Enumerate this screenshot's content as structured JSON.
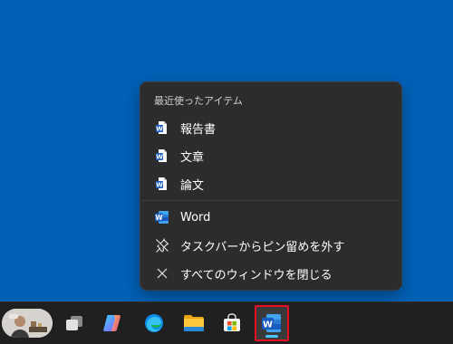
{
  "jumplist": {
    "header": "最近使ったアイテム",
    "recent_items": [
      {
        "label": "報告書",
        "icon": "word-document-icon"
      },
      {
        "label": "文章",
        "icon": "word-document-icon"
      },
      {
        "label": "論文",
        "icon": "word-document-icon"
      }
    ],
    "app_item": {
      "label": "Word",
      "icon": "word-app-icon"
    },
    "unpin_item": {
      "label": "タスクバーからピン留めを外す",
      "icon": "unpin-icon"
    },
    "close_all_item": {
      "label": "すべてのウィンドウを閉じる",
      "icon": "close-icon"
    }
  },
  "taskbar": {
    "items": [
      {
        "name": "weather-widget"
      },
      {
        "name": "task-view"
      },
      {
        "name": "copilot"
      },
      {
        "name": "edge"
      },
      {
        "name": "file-explorer"
      },
      {
        "name": "microsoft-store"
      },
      {
        "name": "word",
        "active": true
      }
    ]
  },
  "colors": {
    "desktop": "#0061b6",
    "menu_bg": "#2c2c2c",
    "taskbar_bg": "#202020",
    "word_blue": "#185abd",
    "highlight_red": "#e81123"
  }
}
